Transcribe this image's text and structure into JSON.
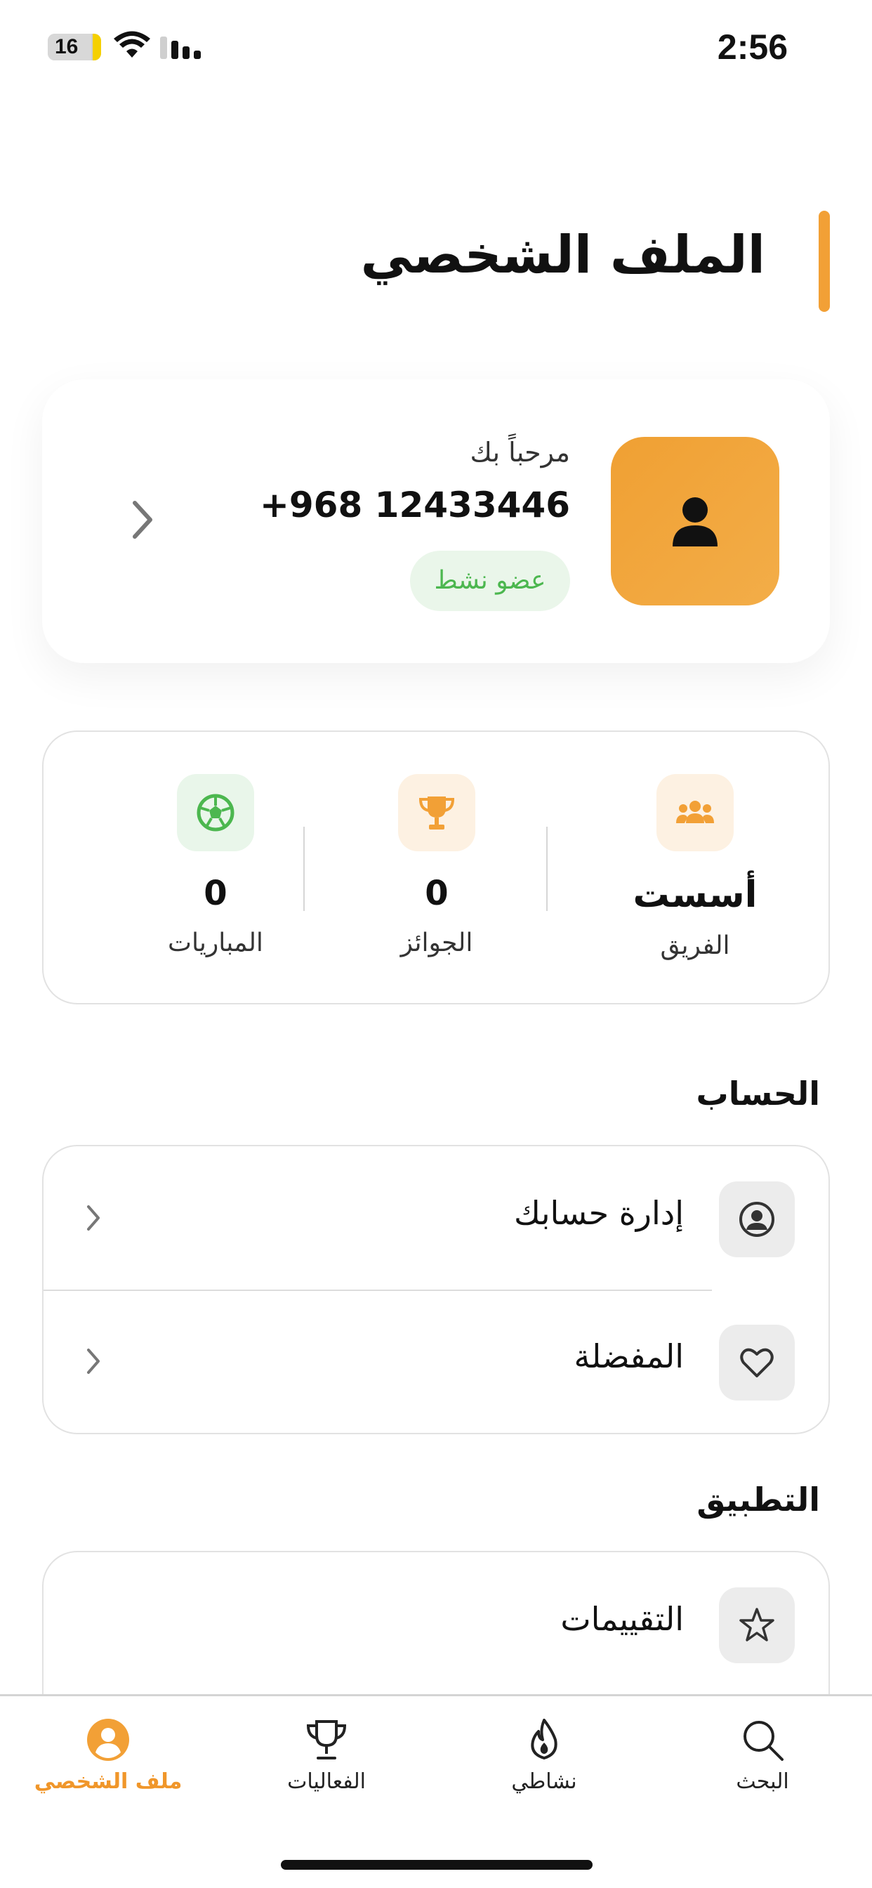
{
  "status_bar": {
    "time": "2:56",
    "battery_level": "16"
  },
  "header": {
    "title": "الملف الشخصي"
  },
  "profile": {
    "welcome": "مرحباً بك",
    "phone": "+968 12433446",
    "badge": "عضو نشط"
  },
  "stats": {
    "team": {
      "value": "أسست",
      "label": "الفريق"
    },
    "awards": {
      "value": "0",
      "label": "الجوائز"
    },
    "matches": {
      "value": "0",
      "label": "المباريات"
    }
  },
  "account_section": {
    "title": "الحساب",
    "items": [
      {
        "label": "إدارة حسابك",
        "icon": "user-circle-icon"
      },
      {
        "label": "المفضلة",
        "icon": "heart-icon"
      }
    ]
  },
  "app_section": {
    "title": "التطبيق",
    "items": [
      {
        "label": "التقييمات",
        "icon": "star-icon"
      }
    ]
  },
  "tab_bar": {
    "items": [
      {
        "label": "ملف الشخصي",
        "icon": "profile-icon",
        "active": true
      },
      {
        "label": "الفعاليات",
        "icon": "trophy-icon",
        "active": false
      },
      {
        "label": "نشاطي",
        "icon": "flame-icon",
        "active": false
      },
      {
        "label": "البحث",
        "icon": "search-icon",
        "active": false
      }
    ]
  },
  "colors": {
    "accent": "#f2a036",
    "active_green": "#4cb74f",
    "badge_bg": "#eaf6ea"
  }
}
